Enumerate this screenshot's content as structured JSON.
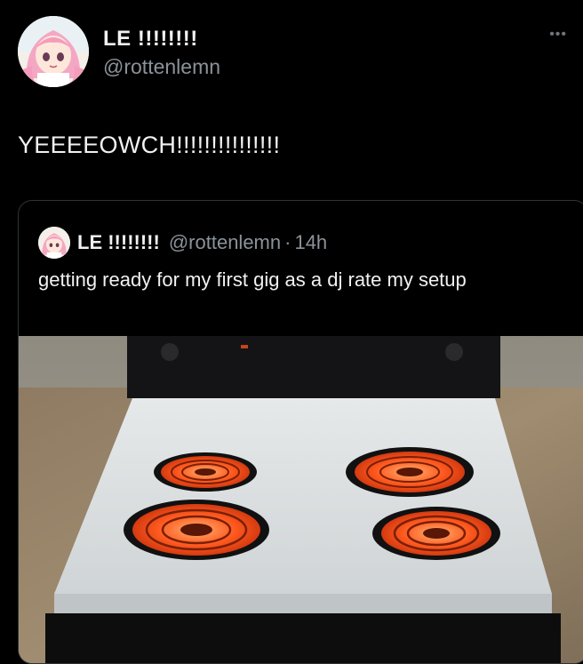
{
  "tweet": {
    "display_name": "LE !!!!!!!!",
    "handle": "@rottenlemn",
    "more_icon": "•••",
    "text": "YEEEEOWCH!!!!!!!!!!!!!!!"
  },
  "quote": {
    "display_name": "LE !!!!!!!!",
    "handle": "@rottenlemn",
    "separator": "·",
    "time": "14h",
    "text": "getting ready for my first gig as a dj rate my setup"
  },
  "colors": {
    "background": "#000000",
    "text": "#f1f1f1",
    "secondary": "#8b9299",
    "border": "#2f3336",
    "burner": "#ff5a1f"
  }
}
